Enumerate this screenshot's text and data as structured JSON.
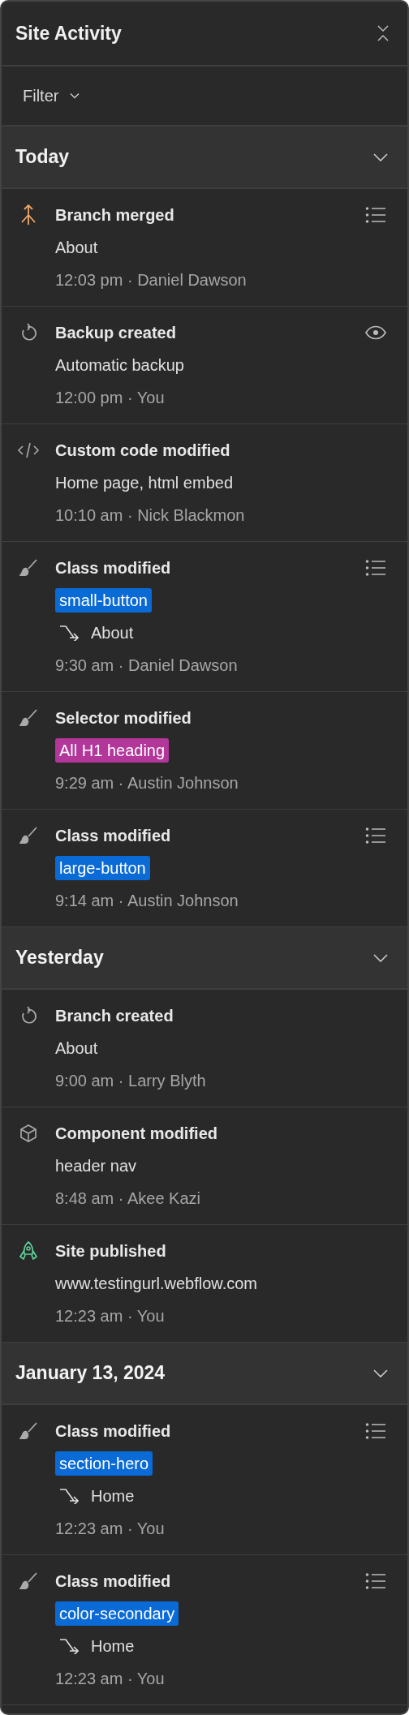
{
  "panel": {
    "title": "Site Activity"
  },
  "filter": {
    "label": "Filter"
  },
  "groups": [
    {
      "label": "Today",
      "expanded": true,
      "items": [
        {
          "kind": "merge",
          "title": "Branch merged",
          "detail": "About",
          "meta": "12:03 pm · Daniel Dawson",
          "action": {
            "kind": "list"
          }
        },
        {
          "kind": "backup",
          "title": "Backup created",
          "detail": "Automatic backup",
          "meta": "12:00 pm · You",
          "action": {
            "kind": "view"
          }
        },
        {
          "kind": "code",
          "title": "Custom code modified",
          "detail": "Home page, html embed",
          "meta": "10:10 am · Nick Blackmon"
        },
        {
          "kind": "style",
          "title": "Class modified",
          "tag": "small-button",
          "color": "#0a6ad6",
          "page": "About",
          "meta": "9:30 am · Daniel Dawson",
          "action": {
            "kind": "list"
          }
        },
        {
          "kind": "style",
          "title": "Selector modified",
          "tag": "All H1 heading",
          "color": "#b3369a",
          "meta": "9:29 am · Austin Johnson"
        },
        {
          "kind": "style",
          "title": "Class modified",
          "tag": "large-button",
          "color": "#0a6ad6",
          "meta": "9:14 am · Austin Johnson",
          "action": {
            "kind": "list"
          }
        }
      ]
    },
    {
      "label": "Yesterday",
      "expanded": true,
      "items": [
        {
          "kind": "backup",
          "title": "Branch created",
          "detail": "About",
          "meta": "9:00 am · Larry Blyth"
        },
        {
          "kind": "component",
          "title": "Component modified",
          "detail": "header nav",
          "meta": "8:48 am · Akee Kazi"
        },
        {
          "kind": "publish",
          "title": "Site published",
          "detail": "www.testingurl.webflow.com",
          "meta": "12:23 am · You"
        }
      ]
    },
    {
      "label": "January 13, 2024",
      "expanded": true,
      "items": [
        {
          "kind": "style",
          "title": "Class modified",
          "tag": "section-hero",
          "color": "#0a6ad6",
          "page": "Home",
          "meta": "12:23 am · You",
          "action": {
            "kind": "list"
          }
        },
        {
          "kind": "style",
          "title": "Class modified",
          "tag": "color-secondary",
          "color": "#0a6ad6",
          "page": "Home",
          "meta": "12:23 am · You",
          "action": {
            "kind": "list"
          }
        }
      ]
    }
  ]
}
